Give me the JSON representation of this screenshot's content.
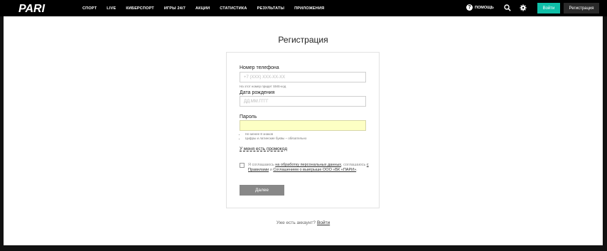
{
  "header": {
    "logo_text": "PARI",
    "nav": [
      "СПОРТ",
      "LIVE",
      "КИБЕРСПОРТ",
      "ИГРЫ 24/7",
      "АКЦИИ",
      "СТАТИСТИКА",
      "РЕЗУЛЬТАТЫ",
      "ПРИЛОЖЕНИЯ"
    ],
    "help_label": "ПОМОЩЬ",
    "login_label": "Войти",
    "register_label": "Регистрация",
    "icons": [
      "help-icon",
      "search-icon",
      "gear-icon"
    ]
  },
  "page": {
    "title": "Регистрация"
  },
  "form": {
    "phone_label": "Номер телефона",
    "phone_placeholder": "+7 (XXX) XXX-XX-XX",
    "phone_hint": "На этот номер придет SMS-код",
    "birth_label": "Дата рождения",
    "birth_placeholder": "ДД.ММ.ГГГГ",
    "password_label": "Пароль",
    "password_value": "",
    "password_rules": [
      "Не менее 8 знаков",
      "Цифры и латинские буквы – обязательно"
    ],
    "promo_label": "У меня есть промокод",
    "consent": {
      "text1": "Я соглашаюсь ",
      "link1": "на обработку персональных данных",
      "text2": ", соглашаюсь ",
      "link2": "с Правилами",
      "text3": " и ",
      "link3": "Соглашением о выигрыше ООО «БК «ПАРИ»",
      "text4": "."
    },
    "submit_label": "Далее"
  },
  "footer": {
    "have_account": "Уже есть аккаунт?",
    "login_link": "Войти"
  },
  "colors": {
    "accent": "#0fbfa8",
    "header_bg": "#000000",
    "password_bg": "#fdffc4",
    "submit_bg": "#888888"
  }
}
